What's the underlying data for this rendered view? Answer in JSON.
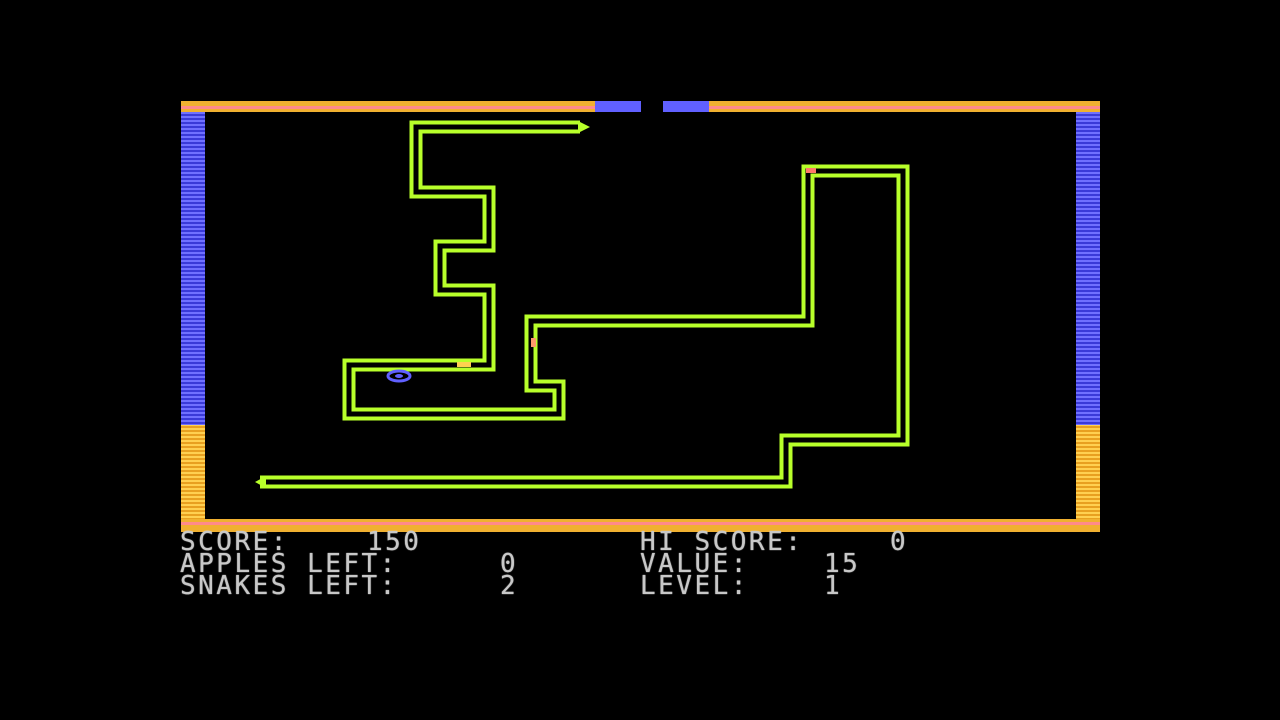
{
  "game": {
    "colors": {
      "background": "#000000",
      "wall_orange": "#f0b030",
      "wall_pink": "#ff7a8c",
      "wall_blue": "#5a5aff",
      "snake_green": "#b8ff2a",
      "apple": "#ff7a6a",
      "text": "#c8c8c8"
    }
  },
  "hud": {
    "score_label": "SCORE:",
    "score_value": "150",
    "hi_score_label": "HI SCORE:",
    "hi_score_value": "0",
    "apples_left_label": "APPLES LEFT:",
    "apples_left_value": "0",
    "value_label": "VALUE:",
    "value_value": "15",
    "snakes_left_label": "SNAKES LEFT:",
    "snakes_left_value": "2",
    "level_label": "LEVEL:",
    "level_value": "1"
  }
}
